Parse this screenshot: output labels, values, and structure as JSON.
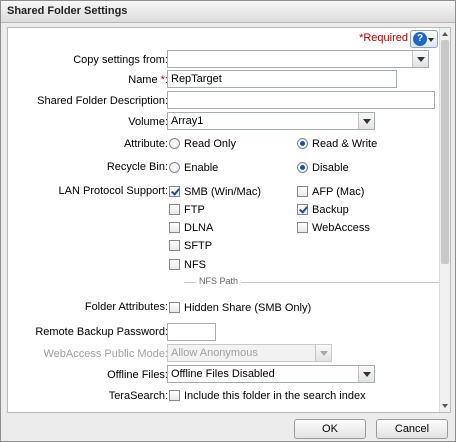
{
  "window": {
    "title": "Shared Folder Settings"
  },
  "header": {
    "required_label": "*Required",
    "help_glyph": "?"
  },
  "form": {
    "copy_settings": {
      "label": "Copy settings from:",
      "value": ""
    },
    "name": {
      "label": "Name",
      "star": "*:",
      "value": "RepTarget"
    },
    "description": {
      "label": "Shared Folder Description:",
      "value": ""
    },
    "volume": {
      "label": "Volume:",
      "value": "Array1"
    },
    "attribute": {
      "label": "Attribute:",
      "options": [
        {
          "label": "Read Only",
          "selected": false
        },
        {
          "label": "Read & Write",
          "selected": true
        }
      ]
    },
    "recycle_bin": {
      "label": "Recycle Bin:",
      "options": [
        {
          "label": "Enable",
          "selected": false
        },
        {
          "label": "Disable",
          "selected": true
        }
      ]
    },
    "lan_protocol": {
      "label": "LAN Protocol Support:",
      "left": [
        {
          "label": "SMB (Win/Mac)",
          "checked": true
        },
        {
          "label": "FTP",
          "checked": false
        },
        {
          "label": "DLNA",
          "checked": false
        },
        {
          "label": "SFTP",
          "checked": false
        },
        {
          "label": "NFS",
          "checked": false
        }
      ],
      "right": [
        {
          "label": "AFP (Mac)",
          "checked": false
        },
        {
          "label": "Backup",
          "checked": true
        },
        {
          "label": "WebAccess",
          "checked": false
        }
      ],
      "nfs_path_label": "NFS Path"
    },
    "folder_attributes": {
      "label": "Folder Attributes:",
      "option": "Hidden Share (SMB Only)",
      "checked": false
    },
    "remote_backup_password": {
      "label": "Remote Backup Password:",
      "value": ""
    },
    "webaccess_public_mode": {
      "label": "WebAccess Public Mode:",
      "value": "Allow Anonymous",
      "disabled": true
    },
    "offline_files": {
      "label": "Offline Files:",
      "value": "Offline Files Disabled"
    },
    "terasearch": {
      "label": "TeraSearch:",
      "option": "Include this folder in the search index",
      "checked": false
    }
  },
  "footer": {
    "ok_label": "OK",
    "cancel_label": "Cancel"
  },
  "colors": {
    "required": "#b10000",
    "selected": "#1f4fa7",
    "help": "#1e67c8"
  }
}
